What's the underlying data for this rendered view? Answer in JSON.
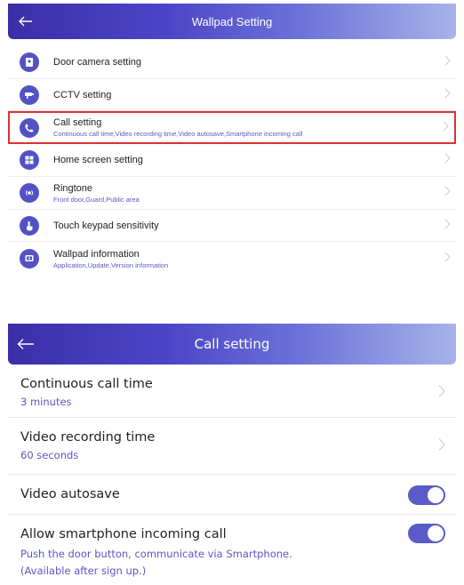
{
  "screen1": {
    "header": {
      "title": "Wallpad Setting",
      "back_icon": "arrow-left-icon"
    },
    "items": [
      {
        "label": "Door camera setting",
        "icon": "door-camera-icon"
      },
      {
        "label": "CCTV setting",
        "icon": "cctv-icon"
      },
      {
        "label": "Call setting",
        "sub": "Continuous call time,Video recording time,Video autosave,Smartphone incoming call",
        "icon": "phone-icon",
        "highlighted": true
      },
      {
        "label": "Home screen setting",
        "icon": "grid-icon"
      },
      {
        "label": "Ringtone",
        "sub": "Front door,Guard,Public area",
        "icon": "ringtone-icon"
      },
      {
        "label": "Touch keypad sensitivity",
        "icon": "touch-icon"
      },
      {
        "label": "Wallpad information",
        "sub": "Application,Update,Version information",
        "icon": "device-info-icon"
      }
    ]
  },
  "screen2": {
    "header": {
      "title": "Call setting",
      "back_icon": "arrow-left-icon"
    },
    "rows": [
      {
        "label": "Continuous call time",
        "value": "3 minutes"
      },
      {
        "label": "Video recording time",
        "value": "60 seconds"
      },
      {
        "label": "Video autosave",
        "toggle": true
      },
      {
        "label": "Allow smartphone incoming call",
        "note1": "Push the door button, communicate via Smartphone.",
        "note2": "(Available after sign up.)",
        "toggle": true
      }
    ]
  },
  "colors": {
    "accent": "#5352c4",
    "highlight_border": "#e03030",
    "sub_text": "#5a58c4"
  }
}
